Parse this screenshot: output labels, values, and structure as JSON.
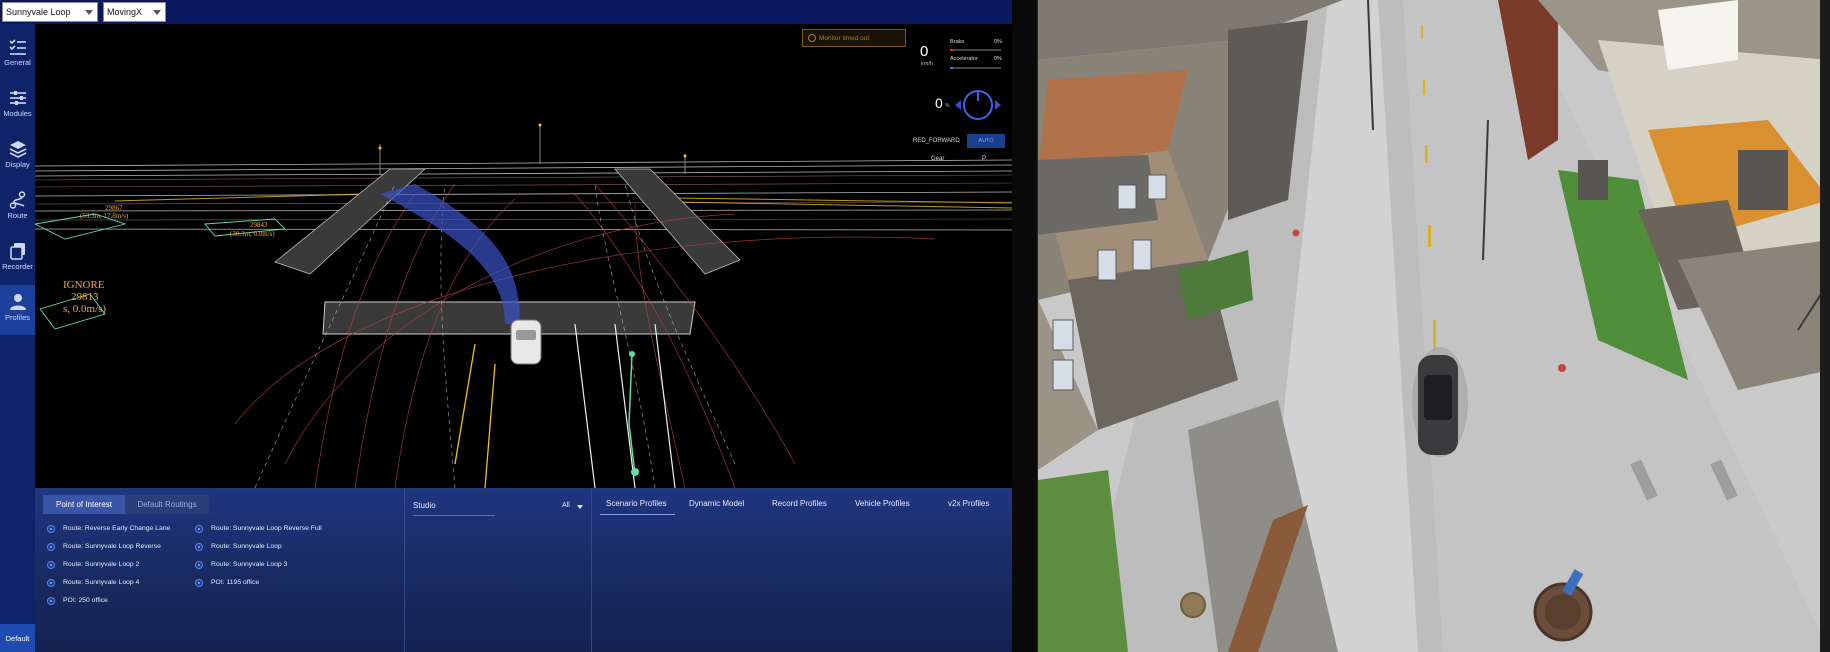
{
  "topbar": {
    "map_select": "Sunnyvale Loop",
    "vehicle_select": "MovingX"
  },
  "sidebar": {
    "items": [
      {
        "label": "General",
        "icon": "general-icon"
      },
      {
        "label": "Modules",
        "icon": "modules-icon"
      },
      {
        "label": "Display",
        "icon": "display-icon"
      },
      {
        "label": "Route",
        "icon": "route-icon"
      },
      {
        "label": "Recorder",
        "icon": "recorder-icon"
      },
      {
        "label": "Profiles",
        "icon": "profiles-icon"
      }
    ],
    "default_label": "Default"
  },
  "hud": {
    "monitor_message": "Monitor timed out",
    "speed": "0",
    "speed_unit": "km/h",
    "brake_label": "Brake",
    "brake_pct": "0%",
    "accelerator_label": "Accelerator",
    "accelerator_pct": "0%",
    "steering": "0",
    "steering_unit": "%",
    "drive_mode": "RED_FORWARD",
    "auto_label": "AUTO",
    "gear_label": "Gear",
    "gear_value": "P"
  },
  "scene_labels": {
    "ignore_line1": "IGNORE",
    "ignore_line2": "29813",
    "ignore_line3": "s, 0.0m/s)",
    "obstacle_a_id": "29867",
    "obstacle_a_info": "(53.3m, 17.8m/s)",
    "obstacle_b_id": "29843",
    "obstacle_b_info": "(30.3m, 0.0m/s)"
  },
  "bottom": {
    "tabs": {
      "poi": "Point of Interest",
      "routing": "Default Routings"
    },
    "poi_left": [
      "Route: Reverse Early Change Lane",
      "Route: Sunnyvale Loop Reverse",
      "Route: Sunnyvale Loop 2",
      "Route: Sunnyvale Loop 4",
      "POI: 250 office"
    ],
    "poi_right": [
      "Route: Sunnyvale Loop Reverse Full",
      "Route: Sunnyvale Loop",
      "Route: Sunnyvale Loop 3",
      "POI: 1195 office"
    ],
    "studio": {
      "title": "Studio",
      "filter": "All"
    },
    "profile_tabs": [
      "Scenario Profiles",
      "Dynamic Model",
      "Record Profiles",
      "Vehicle Profiles",
      "v2x Profiles"
    ]
  }
}
